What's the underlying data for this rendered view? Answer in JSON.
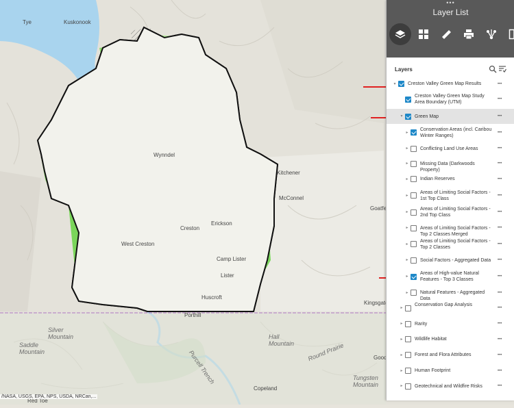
{
  "map": {
    "labels": [
      {
        "key": "tye",
        "text": "Tye"
      },
      {
        "key": "kuskonook",
        "text": "Kuskonook"
      },
      {
        "key": "kitchener",
        "text": "Kitchener"
      },
      {
        "key": "mcconnel",
        "text": "McConnel"
      },
      {
        "key": "goatfell",
        "text": "Goatfell"
      },
      {
        "key": "wynndel",
        "text": "Wynndel"
      },
      {
        "key": "creston",
        "text": "Creston"
      },
      {
        "key": "erickson",
        "text": "Erickson"
      },
      {
        "key": "lister",
        "text": "Lister"
      },
      {
        "key": "camp_lister",
        "text": "Camp Lister"
      },
      {
        "key": "huscroft",
        "text": "Huscroft"
      },
      {
        "key": "west_creston",
        "text": "West Creston"
      },
      {
        "key": "kingsgate",
        "text": "Kingsgate"
      },
      {
        "key": "porthill",
        "text": "Porthill"
      },
      {
        "key": "good",
        "text": "Good"
      },
      {
        "key": "copeland",
        "text": "Copeland"
      },
      {
        "key": "red_toe",
        "text": "Red Toe"
      },
      {
        "key": "saddle_mountain",
        "text": "Saddle\nMountain"
      },
      {
        "key": "silver_mountain",
        "text": "Silver\nMountain"
      },
      {
        "key": "hall_mountain",
        "text": "Hall\nMountain"
      },
      {
        "key": "tungsten_mountain",
        "text": "Tungsten\nMountain"
      },
      {
        "key": "purcell_trench",
        "text": "Purcell Trench"
      },
      {
        "key": "round_prairie",
        "text": "Round Prairie"
      }
    ],
    "attribution": "/NASA, USGS, EPA, NPS, USDA, NRCan,..."
  },
  "panel": {
    "title": "Layer List",
    "toolbar": [
      "layers-icon",
      "basemap-icon",
      "measure-icon",
      "print-icon",
      "share-icon",
      "layout-icon"
    ],
    "layers_heading": "Layers",
    "colors": {
      "header": "#595959",
      "accent": "#1e88c8",
      "highlight": "#e3e3e3"
    },
    "rows": [
      {
        "label": "Creston Valley Green Map Results",
        "checked": true,
        "expanded": true,
        "indent": 0,
        "height": 17,
        "highlight": false,
        "arrow": true
      },
      {
        "label": "Creston Valley Green Map Study Area Boundary (UTM)",
        "checked": true,
        "expanded": false,
        "indent": 1,
        "height": 28,
        "highlight": false,
        "arrow": false,
        "noChevron": true
      },
      {
        "label": "Green Map",
        "checked": true,
        "expanded": true,
        "indent": 1,
        "height": 22,
        "highlight": true,
        "arrow": true
      },
      {
        "label": "Conservation Areas (incl. Caribou Winter Ranges)",
        "checked": true,
        "expanded": false,
        "indent": 2,
        "height": 25,
        "highlight": false,
        "arrow": false
      },
      {
        "label": "Conflicting Land Use Areas",
        "checked": false,
        "expanded": false,
        "indent": 2,
        "height": 22,
        "highlight": false,
        "arrow": false
      },
      {
        "label": "Missing Data (Darkwoods Property)",
        "checked": false,
        "expanded": false,
        "indent": 2,
        "height": 22,
        "highlight": false,
        "arrow": false
      },
      {
        "label": "Indian Reserves",
        "checked": false,
        "expanded": false,
        "indent": 2,
        "height": 23,
        "highlight": false,
        "arrow": false
      },
      {
        "label": "Areas of Limiting Social Factors - 1st Top Class",
        "checked": false,
        "expanded": false,
        "indent": 2,
        "height": 25,
        "highlight": false,
        "arrow": false
      },
      {
        "label": "Areas of Limiting Social Factors - 2nd Top Class",
        "checked": false,
        "expanded": false,
        "indent": 2,
        "height": 24,
        "highlight": false,
        "arrow": false
      },
      {
        "label": "Areas of Limiting Social Factors - Top 2 Classes Merged",
        "checked": false,
        "expanded": false,
        "indent": 2,
        "height": 22,
        "highlight": false,
        "arrow": false
      },
      {
        "label": "Areas of Limiting Social Factors - Top 2 Classes",
        "checked": false,
        "expanded": false,
        "indent": 2,
        "height": 25,
        "highlight": false,
        "arrow": false
      },
      {
        "label": "Social Factors - Aggregated Data",
        "checked": false,
        "expanded": false,
        "indent": 2,
        "height": 22,
        "highlight": false,
        "arrow": false
      },
      {
        "label": "Areas of High-value Natural Features - Top 3 Classes",
        "checked": true,
        "expanded": false,
        "indent": 2,
        "height": 26,
        "highlight": false,
        "arrow": true
      },
      {
        "label": "Natural Features - Aggregated Data",
        "checked": false,
        "expanded": false,
        "indent": 2,
        "height": 21,
        "highlight": false,
        "arrow": false
      },
      {
        "label": "Conservation Gap Analysis",
        "checked": false,
        "expanded": false,
        "indent": 1,
        "height": 24,
        "highlight": false,
        "arrow": false
      },
      {
        "label": "Rarity",
        "checked": false,
        "expanded": false,
        "indent": 1,
        "height": 22,
        "highlight": false,
        "arrow": false
      },
      {
        "label": "Wildlife Habitat",
        "checked": false,
        "expanded": false,
        "indent": 1,
        "height": 23,
        "highlight": false,
        "arrow": false
      },
      {
        "label": "Forest and Flora Attributes",
        "checked": false,
        "expanded": false,
        "indent": 1,
        "height": 23,
        "highlight": false,
        "arrow": false
      },
      {
        "label": "Human Footprint",
        "checked": false,
        "expanded": false,
        "indent": 1,
        "height": 23,
        "highlight": false,
        "arrow": false
      },
      {
        "label": "Geotechnical and Wildfire Risks",
        "checked": false,
        "expanded": false,
        "indent": 1,
        "height": 22,
        "highlight": false,
        "arrow": false
      }
    ]
  }
}
